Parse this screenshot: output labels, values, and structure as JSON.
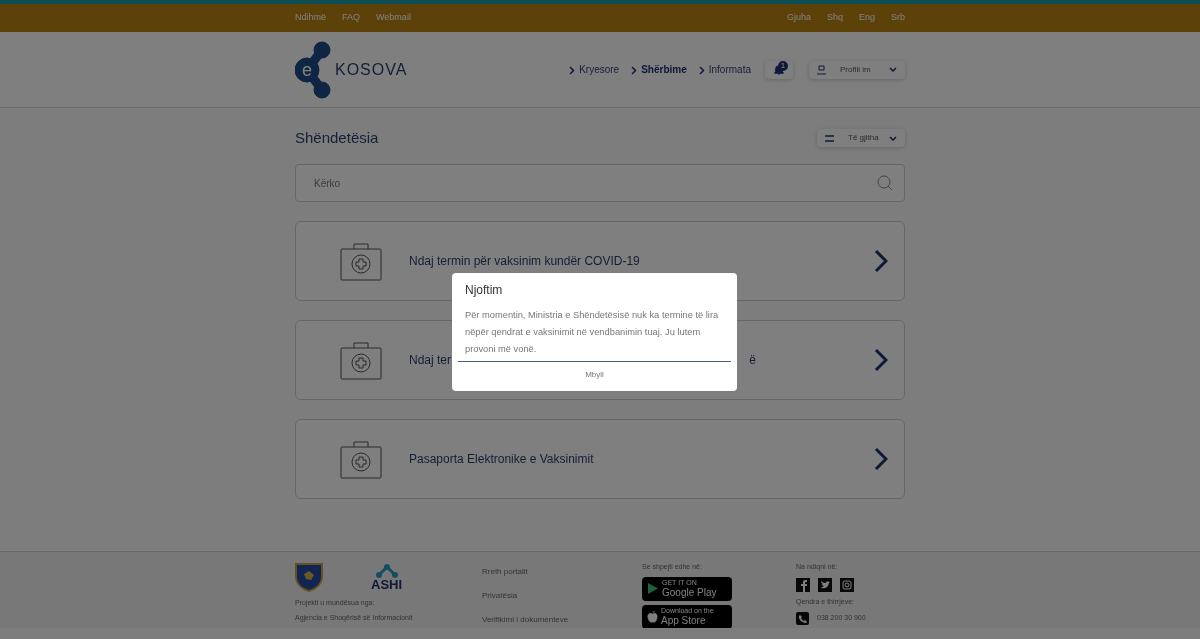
{
  "top_bar": {
    "links": [
      "Ndihmë",
      "FAQ",
      "Webmail"
    ],
    "language_label": "Gjuha",
    "languages": [
      "Shq",
      "Eng",
      "Srb"
    ]
  },
  "header": {
    "logo": {
      "letter": "e",
      "text": "KOSOVA"
    },
    "nav": [
      {
        "label": "Kryesore",
        "selected": false
      },
      {
        "label": "Shërbime",
        "selected": true
      },
      {
        "label": "Informata",
        "selected": false
      }
    ],
    "notifications": {
      "count": "1"
    },
    "profile": {
      "label": "Profili im"
    }
  },
  "page": {
    "title": "Shëndetësia",
    "filter": {
      "label": "Të gjitha"
    },
    "search": {
      "placeholder": "Kërko"
    },
    "services": [
      {
        "title_start": "Ndaj termin për vaksinim kundër COVID-19"
      },
      {
        "title_start": "Ndaj ter",
        "title_end": "ë"
      },
      {
        "title_start": "Pasaporta Elektronike e Vaksinimit"
      }
    ]
  },
  "modal": {
    "title": "Njoftim",
    "body": "Për momentin, Ministria e Shëndetësisë nuk ka termine të lira nëpër qendrat e vaksinimit në vendbanimin tuaj. Ju lutem provoni më vonë.",
    "button": "Mbyll"
  },
  "footer": {
    "sponsor_label": "Projekti u mundësua nga:",
    "sponsor_name": "Agjencia e Shoqërisë së Informacionit",
    "ashi_label": "ASHI",
    "links": [
      "Rreth portalit",
      "Privatësia",
      "Verifikimi i dokumenteve"
    ],
    "apps_label": "Se shpejti edhe në:",
    "apps": [
      {
        "small": "GET IT ON",
        "big": "Google Play",
        "kind": "google"
      },
      {
        "small": "Download on the",
        "big": "App Store",
        "kind": "apple"
      }
    ],
    "social_label": "Na ndiqni në:",
    "call_label": "Qendra e thirrjeve:",
    "phone": "038 200 30 900"
  }
}
